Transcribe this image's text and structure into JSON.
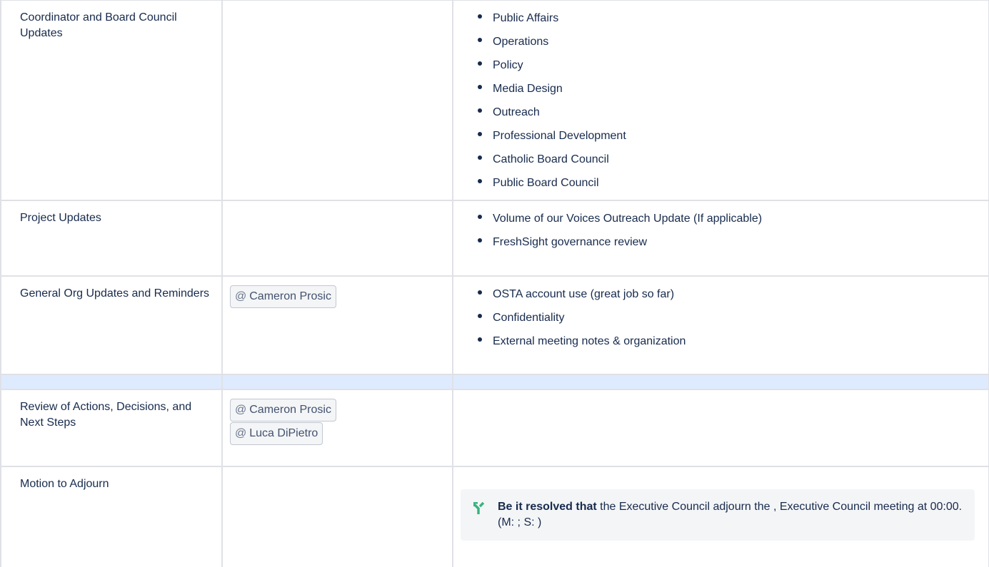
{
  "rows": {
    "coordinator": {
      "topic": "Coordinator and Board Council Updates",
      "items": [
        "Public Affairs",
        "Operations",
        "Policy",
        "Media Design",
        "Outreach",
        "Professional Development",
        "Catholic Board Council",
        "Public Board Council"
      ]
    },
    "project": {
      "topic": "Project Updates",
      "items": [
        "Volume of our Voices Outreach Update (If applicable)",
        "FreshSight governance review"
      ]
    },
    "general": {
      "topic": "General Org Updates and Reminders",
      "mentions": [
        "Cameron Prosic"
      ],
      "items": [
        "OSTA account use (great job so far)",
        "Confidentiality",
        "External meeting notes & organization"
      ]
    },
    "review": {
      "topic": "Review of Actions, Decisions, and Next Steps",
      "mentions": [
        "Cameron Prosic",
        "Luca DiPietro"
      ]
    },
    "motion": {
      "topic": "Motion to Adjourn",
      "resolution": {
        "lead": "Be it resolved that",
        "text": " the Executive Council adjourn the , Executive Council meeting at 00:00. (M: ; S: )",
        "icon": "decision-branch-icon"
      }
    }
  },
  "mention_prefix": "@",
  "colors": {
    "spacer_row": "#deebff",
    "border": "#dfe1e6",
    "decision_icon": "#36b37e"
  }
}
